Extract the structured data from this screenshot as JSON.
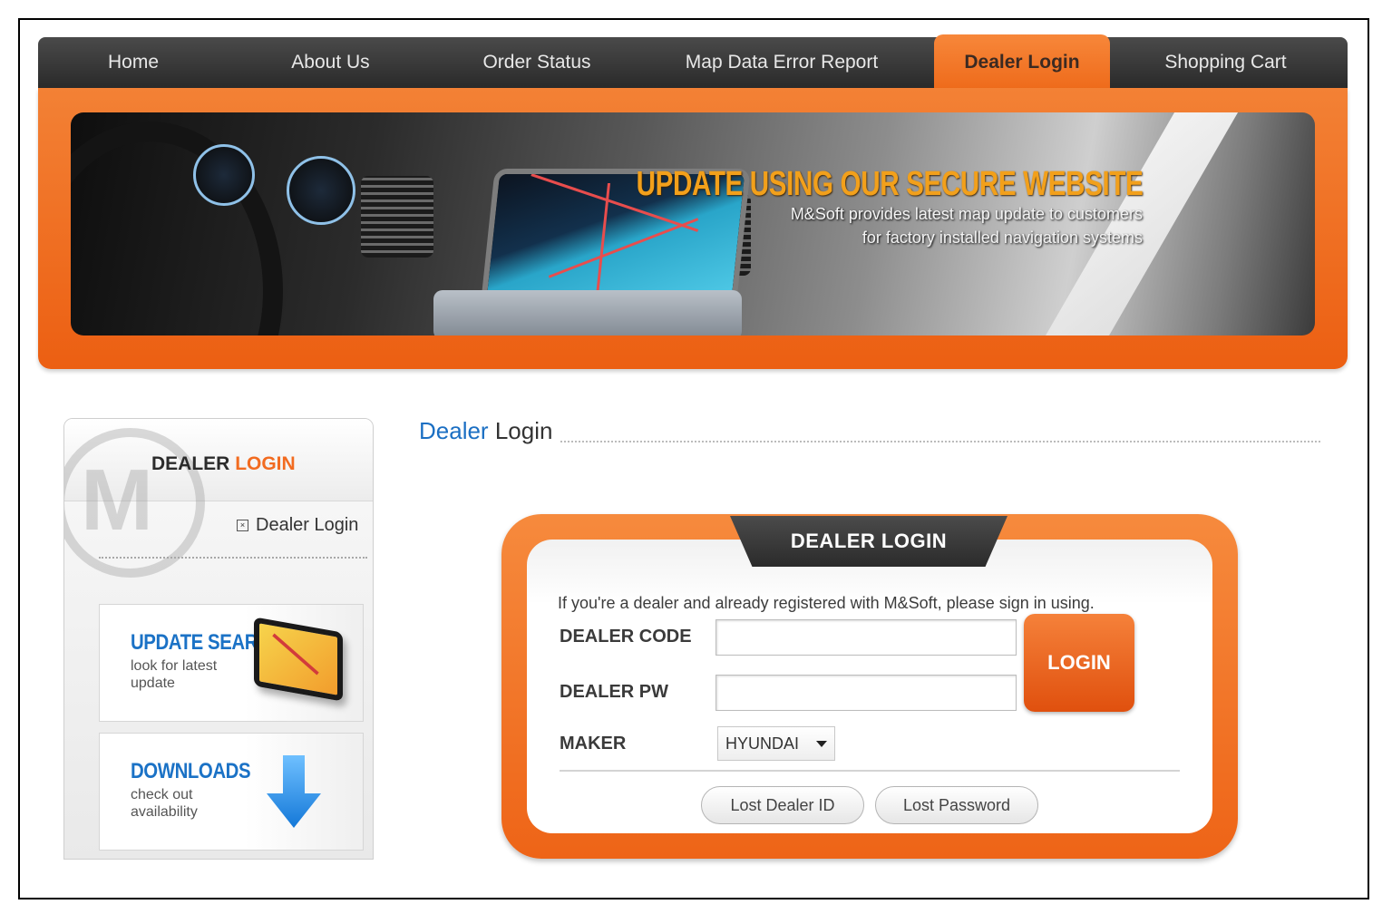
{
  "nav": {
    "items": [
      {
        "label": "Home"
      },
      {
        "label": "About Us"
      },
      {
        "label": "Order Status"
      },
      {
        "label": "Map Data Error Report"
      },
      {
        "label": "Dealer Login"
      },
      {
        "label": "Shopping Cart"
      }
    ],
    "active_index": 4
  },
  "banner": {
    "title": "UPDATE USING OUR SECURE WEBSITE",
    "line1": "M&Soft provides latest map update to customers",
    "line2": "for factory installed navigation systems"
  },
  "sidebar": {
    "title_part1": "DEALER",
    "title_part2": "LOGIN",
    "link": "Dealer Login",
    "promo_update": {
      "title": "UPDATE SEARCH",
      "sub": "look for latest update"
    },
    "promo_downloads": {
      "title": "DOWNLOADS",
      "sub": "check out availability"
    }
  },
  "content": {
    "title_part1": "Dealer",
    "title_part2": "Login"
  },
  "login": {
    "header": "DEALER LOGIN",
    "intro": "If you're a dealer and already registered with M&Soft, please sign in using.",
    "code_label": "DEALER CODE",
    "code_value": "",
    "pw_label": "DEALER PW",
    "pw_value": "",
    "maker_label": "MAKER",
    "maker_value": "HYUNDAI",
    "login_button": "LOGIN",
    "lost_id": "Lost Dealer ID",
    "lost_pw": "Lost Password"
  },
  "colors": {
    "accent": "#ee6a1a",
    "nav_bg": "#2f2f2f",
    "link_blue": "#1b6fc3"
  }
}
